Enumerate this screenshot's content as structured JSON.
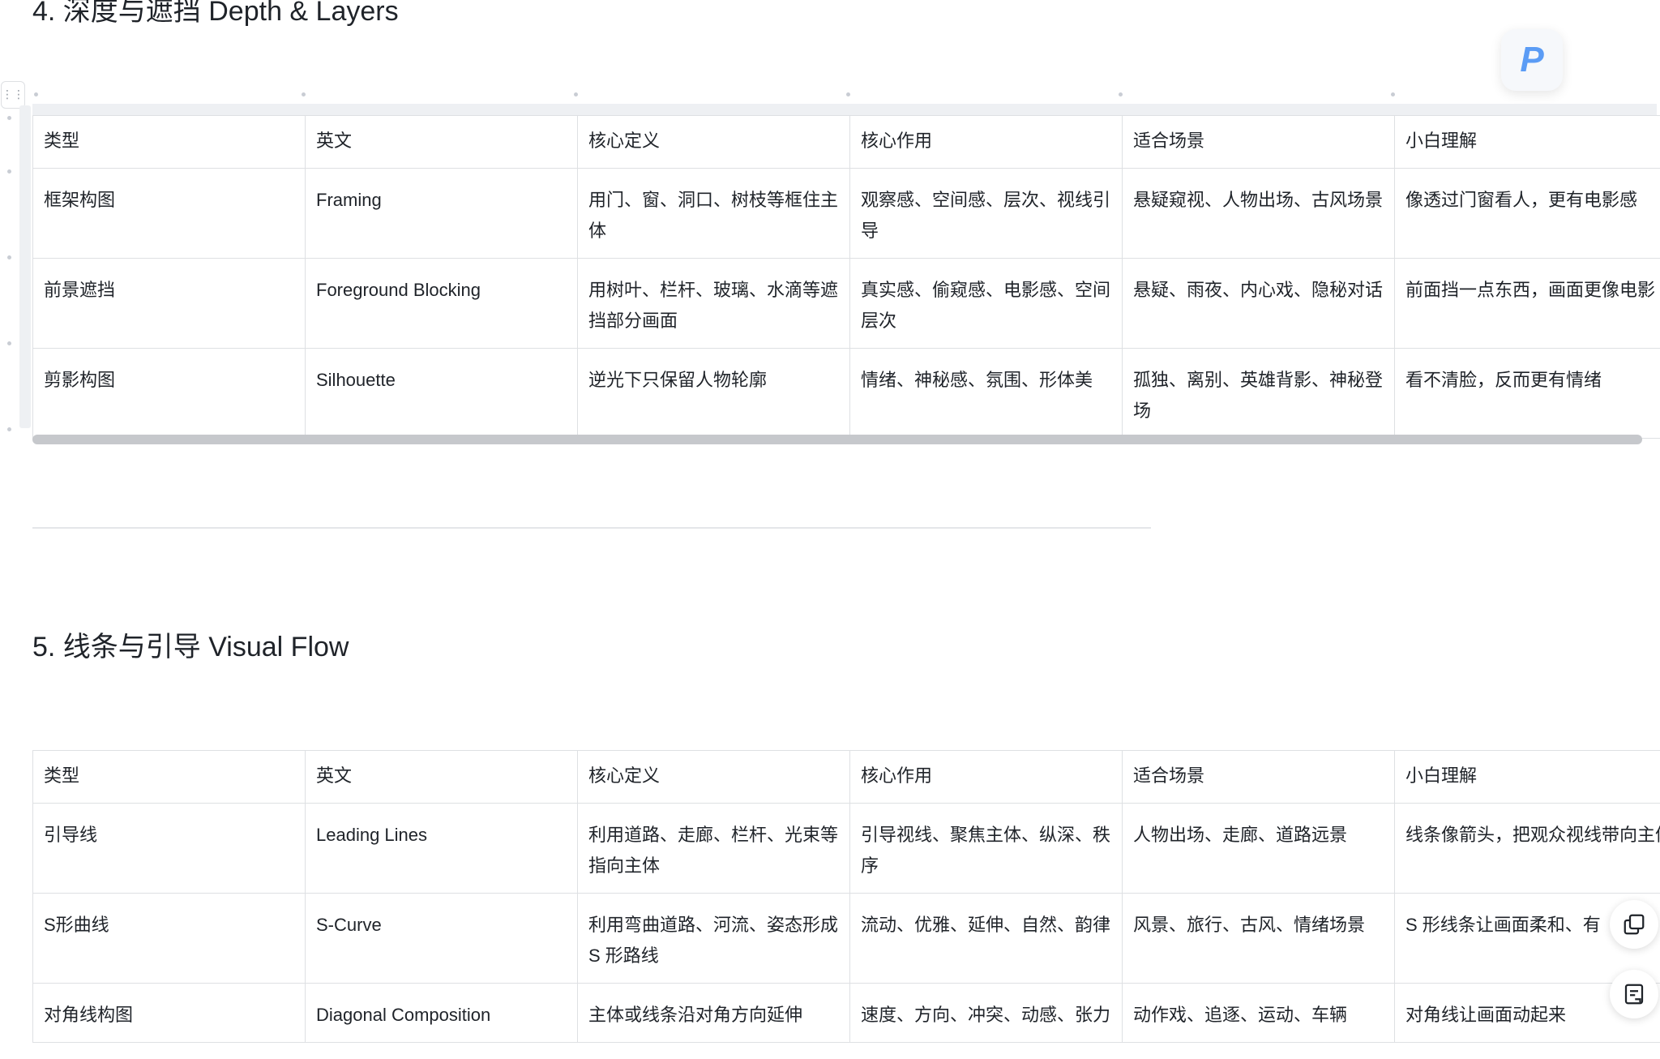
{
  "sections": [
    {
      "heading": "4. 深度与遮挡 Depth & Layers",
      "columns": [
        "类型",
        "英文",
        "核心定义",
        "核心作用",
        "适合场景",
        "小白理解"
      ],
      "rows": [
        [
          "框架构图",
          "Framing",
          "用门、窗、洞口、树枝等框住主体",
          "观察感、空间感、层次、视线引导",
          "悬疑窥视、人物出场、古风场景",
          "像透过门窗看人，更有电影感"
        ],
        [
          "前景遮挡",
          "Foreground Blocking",
          "用树叶、栏杆、玻璃、水滴等遮挡部分画面",
          "真实感、偷窥感、电影感、空间层次",
          "悬疑、雨夜、内心戏、隐秘对话",
          "前面挡一点东西，画面更像电影"
        ],
        [
          "剪影构图",
          "Silhouette",
          "逆光下只保留人物轮廓",
          "情绪、神秘感、氛围、形体美",
          "孤独、离别、英雄背影、神秘登场",
          "看不清脸，反而更有情绪"
        ]
      ]
    },
    {
      "heading": "5. 线条与引导 Visual Flow",
      "columns": [
        "类型",
        "英文",
        "核心定义",
        "核心作用",
        "适合场景",
        "小白理解"
      ],
      "rows": [
        [
          "引导线",
          "Leading Lines",
          "利用道路、走廊、栏杆、光束等指向主体",
          "引导视线、聚焦主体、纵深、秩序",
          "人物出场、走廊、道路远景",
          "线条像箭头，把观众视线带向主体"
        ],
        [
          "S形曲线",
          "S-Curve",
          "利用弯曲道路、河流、姿态形成 S 形路线",
          "流动、优雅、延伸、自然、韵律",
          "风景、旅行、古风、情绪场景",
          "S 形线条让画面柔和、有"
        ],
        [
          "对角线构图",
          "Diagonal Composition",
          "主体或线条沿对角方向延伸",
          "速度、方向、冲突、动感、张力",
          "动作戏、追逐、运动、车辆",
          "对角线让画面动起来"
        ]
      ]
    }
  ],
  "plugin_badge": {
    "label": "P",
    "icon": "plugin-p-icon",
    "color": "#5b9cf5"
  },
  "float_buttons": [
    {
      "icon": "copy-icon"
    },
    {
      "icon": "comment-icon"
    }
  ],
  "colors": {
    "border": "#dee0e3",
    "text": "#1f2329",
    "accent": "#5b9cf5"
  }
}
